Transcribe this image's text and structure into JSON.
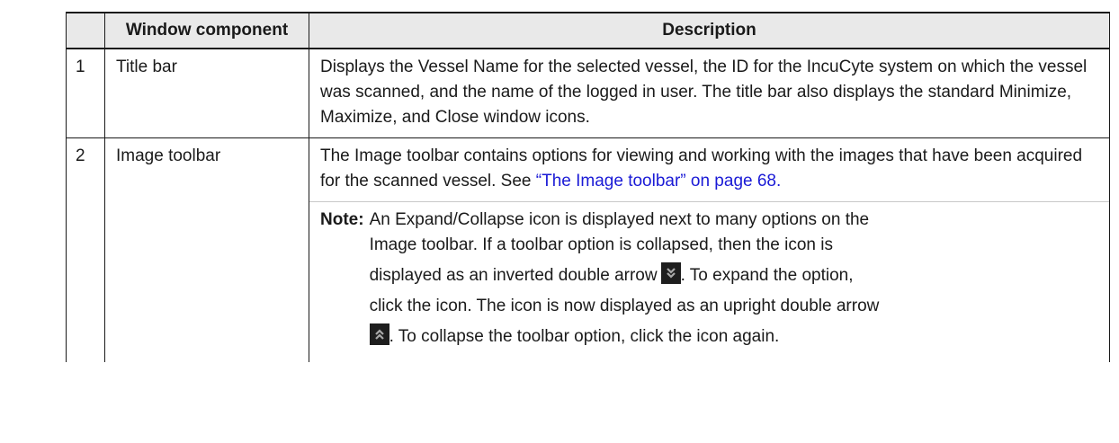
{
  "table": {
    "headers": {
      "col1": "",
      "col2": "Window component",
      "col3": "Description"
    },
    "rows": [
      {
        "number": "1",
        "component": "Title bar",
        "description": "Displays the Vessel Name for the selected vessel, the ID for the IncuCyte system on which the vessel was scanned, and the name of the logged in user. The title bar also displays the standard Minimize, Maximize, and Close window icons."
      },
      {
        "number": "2",
        "component": "Image toolbar",
        "description_before_link": "The Image toolbar contains options for viewing and working with the images that have been acquired for the scanned vessel. See ",
        "link_text": "“The Image toolbar” on page 68.",
        "note_label": "Note:",
        "note_line1": "An Expand/Collapse icon is displayed next to many options on the",
        "note_line2": "Image toolbar. If a toolbar option is collapsed, then the icon is",
        "note_line3": "displayed as an inverted double arrow",
        "note_line3_after": ". To expand the option,",
        "note_line4": "click the icon. The icon is now displayed as an upright double arrow",
        "note_line5_after": ". To collapse the toolbar option, click the icon again."
      }
    ]
  },
  "icons": {
    "collapsed": "double-chevron-down-icon",
    "expanded": "double-chevron-up-icon"
  },
  "colors": {
    "link": "#1a1ad6",
    "header_bg": "#e9e9e9",
    "icon_bg": "#1e1e1e",
    "icon_fg": "#a9a9a9"
  }
}
